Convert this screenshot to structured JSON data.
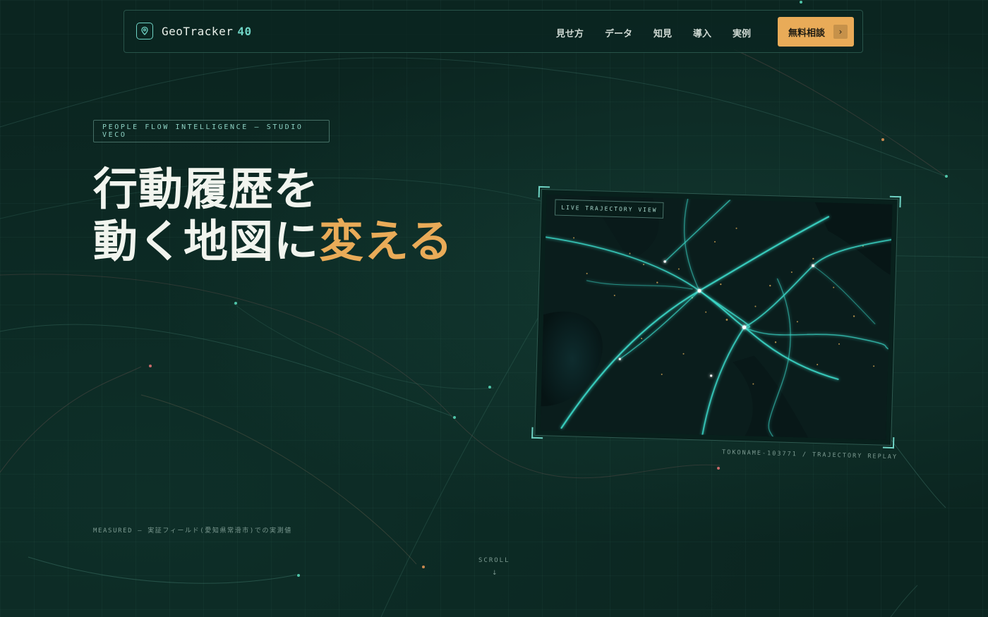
{
  "nav": {
    "logo_name": "GeoTracker",
    "logo_accent": "40",
    "items": [
      "見せ方",
      "データ",
      "知見",
      "導入",
      "実例"
    ],
    "cta_label": "無料相談",
    "cta_arrow": "›"
  },
  "hero": {
    "tag": "PEOPLE FLOW INTELLIGENCE — STUDIO VECO",
    "headline_line1": "行動履歴を",
    "headline_line2_main": "動く地図に",
    "headline_line2_accent": "変える",
    "measured_note": "MEASURED — 実証フィールド(愛知県常滑市)での実測値",
    "scroll_label": "SCROLL",
    "scroll_arrow": "↓"
  },
  "map_card": {
    "live_label": "LIVE TRAJECTORY VIEW",
    "caption": "TOKONAME-103771 / TRAJECTORY REPLAY"
  },
  "colors": {
    "background": "#0b2520",
    "accent_teal": "#6fd3c4",
    "accent_orange": "#e9ab58"
  }
}
